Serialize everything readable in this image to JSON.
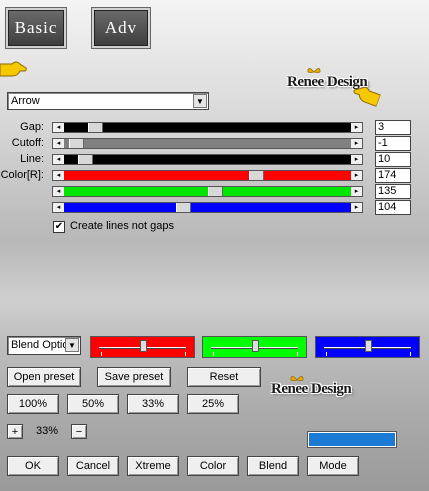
{
  "top_tabs": {
    "basic": "Basic",
    "adv": "Adv"
  },
  "logo": {
    "text": "Renee Design"
  },
  "preset_dropdown": {
    "value": "Arrow"
  },
  "sliders": [
    {
      "label": "Gap:",
      "value": "3",
      "fraction": 0.09,
      "color": "#000000"
    },
    {
      "label": "Cutoff:",
      "value": "-1",
      "fraction": 0.02,
      "color": "#808080"
    },
    {
      "label": "Line:",
      "value": "10",
      "fraction": 0.05,
      "color": "#000000"
    },
    {
      "label": "Color[R]:",
      "value": "174",
      "fraction": 0.68,
      "color": "#ff0000"
    },
    {
      "label": "",
      "value": "135",
      "fraction": 0.53,
      "color": "#00e600"
    },
    {
      "label": "",
      "value": "104",
      "fraction": 0.41,
      "color": "#0000ff"
    }
  ],
  "create_lines_checkbox": {
    "label": "Create lines not gaps",
    "checked": true,
    "mark": "✔"
  },
  "blend_dropdown": {
    "value": "Blend Optio"
  },
  "color_sliders": [
    {
      "color": "#ff0000",
      "fraction": 0.5
    },
    {
      "color": "#00ff00",
      "fraction": 0.5
    },
    {
      "color": "#0000ff",
      "fraction": 0.5
    }
  ],
  "buttons": {
    "open_preset": "Open preset",
    "save_preset": "Save preset",
    "reset": "Reset",
    "z100": "100%",
    "z50": "50%",
    "z33": "33%",
    "z25": "25%",
    "zoom_plus": "+",
    "zoom_value": "33%",
    "zoom_minus": "−",
    "ok": "OK",
    "cancel": "Cancel",
    "xtreme": "Xtreme",
    "color": "Color",
    "blend": "Blend",
    "mode": "Mode"
  },
  "progress_color": "#1a7ad4"
}
